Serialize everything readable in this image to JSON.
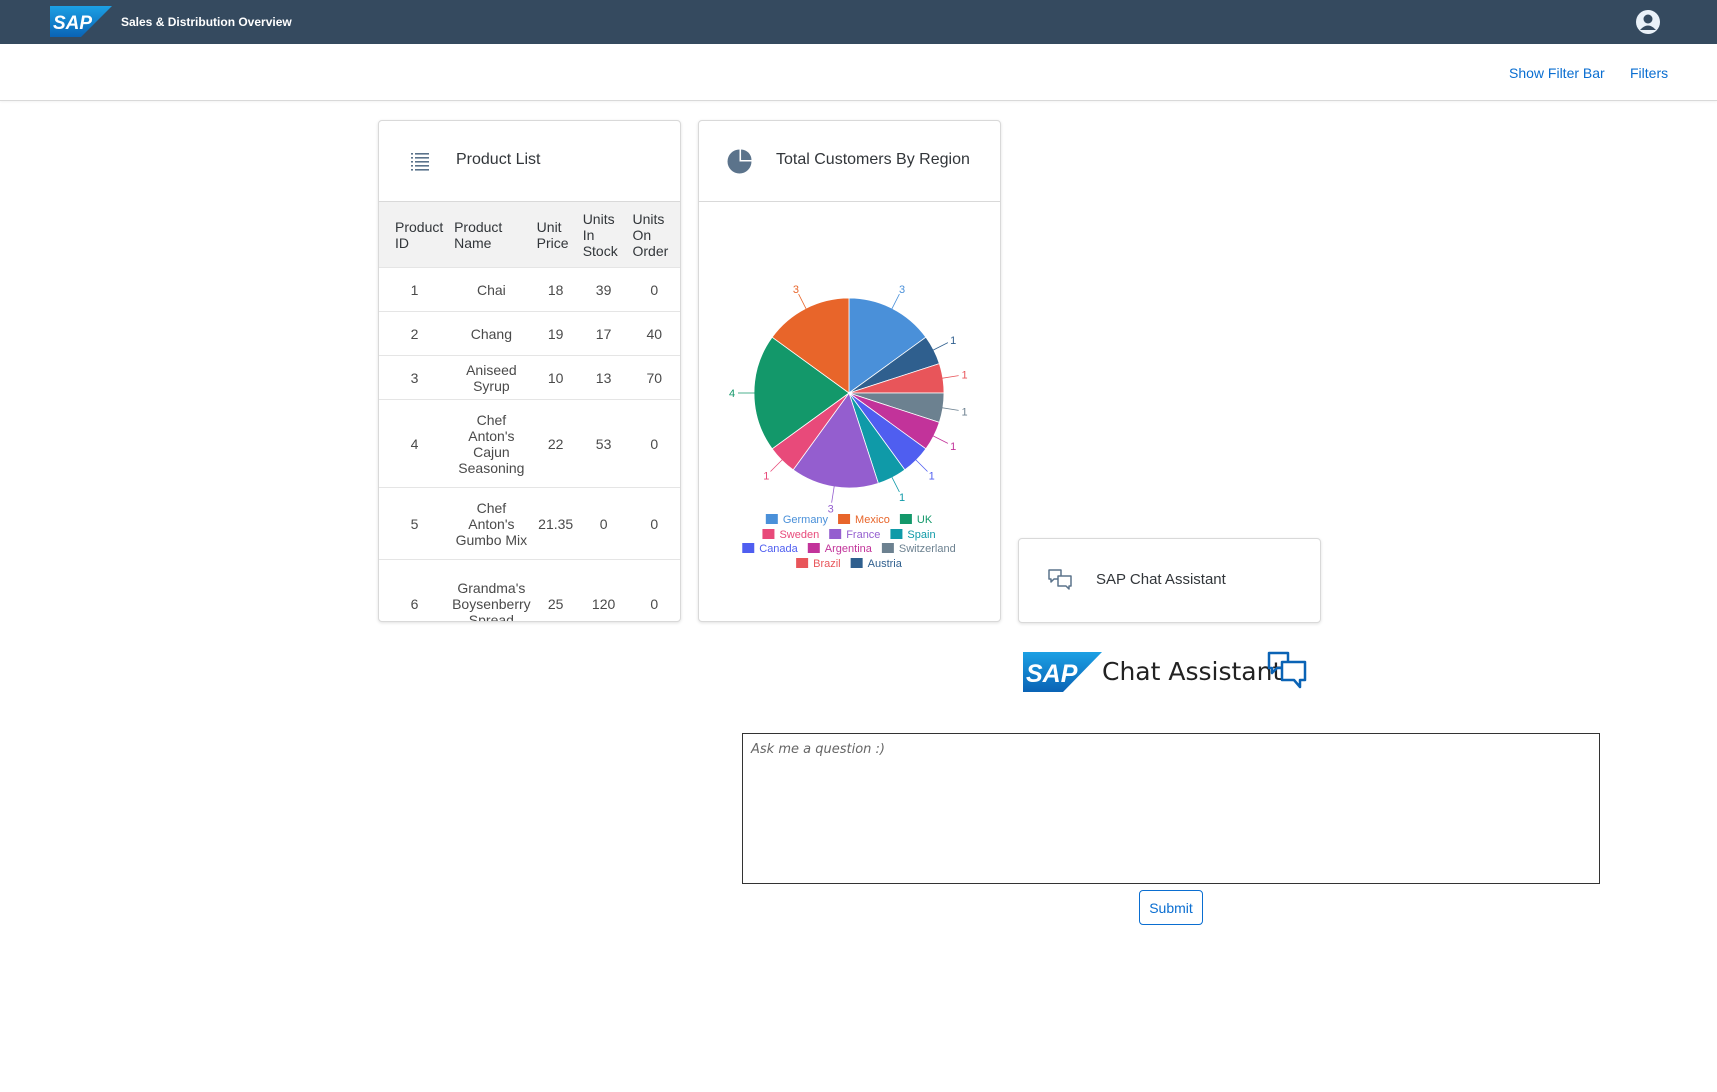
{
  "shell": {
    "app_title": "Sales & Distribution Overview",
    "logo_text": "SAP",
    "avatar_icon": "user-avatar-icon",
    "brand_bg": "#354a5f"
  },
  "toolbar": {
    "show_filter_bar": "Show Filter Bar",
    "filters": "Filters"
  },
  "product_card": {
    "title": "Product List",
    "icon": "list-icon",
    "columns": [
      "Product ID",
      "Product Name",
      "Unit Price",
      "Units In Stock",
      "Units On Order"
    ],
    "rows": [
      [
        "1",
        "Chai",
        "18",
        "39",
        "0"
      ],
      [
        "2",
        "Chang",
        "19",
        "17",
        "40"
      ],
      [
        "3",
        "Aniseed Syrup",
        "10",
        "13",
        "70"
      ],
      [
        "4",
        "Chef Anton's Cajun Seasoning",
        "22",
        "53",
        "0"
      ],
      [
        "5",
        "Chef Anton's Gumbo Mix",
        "21.35",
        "0",
        "0"
      ],
      [
        "6",
        "Grandma's Boysenberry Spread",
        "25",
        "120",
        "0"
      ]
    ]
  },
  "customers_card": {
    "title": "Total Customers By Region",
    "icon": "pie-chart-icon"
  },
  "chart_data": {
    "type": "pie",
    "title": "",
    "legend_position": "bottom",
    "slices": [
      {
        "label": "Germany",
        "value": 3,
        "color": "#4a90d9"
      },
      {
        "label": "Austria",
        "value": 1,
        "color": "#2f5f8e"
      },
      {
        "label": "Brazil",
        "value": 1,
        "color": "#e8555a"
      },
      {
        "label": "Switzerland",
        "value": 1,
        "color": "#6c8190"
      },
      {
        "label": "Argentina",
        "value": 1,
        "color": "#c2339a"
      },
      {
        "label": "Canada",
        "value": 1,
        "color": "#4f5ef0"
      },
      {
        "label": "Spain",
        "value": 1,
        "color": "#0f9aa8"
      },
      {
        "label": "France",
        "value": 3,
        "color": "#945ecf"
      },
      {
        "label": "Sweden",
        "value": 1,
        "color": "#e84a7a"
      },
      {
        "label": "UK",
        "value": 4,
        "color": "#13986a"
      },
      {
        "label": "Mexico",
        "value": 3,
        "color": "#e8652a"
      }
    ],
    "legend_order": [
      [
        "Germany",
        "Mexico",
        "UK"
      ],
      [
        "Sweden",
        "France",
        "Spain"
      ],
      [
        "Canada",
        "Argentina",
        "Switzerland"
      ],
      [
        "Brazil",
        "Austria"
      ]
    ]
  },
  "chat_card": {
    "title": "SAP Chat Assistant",
    "icon": "chat-bubbles-icon"
  },
  "chat_panel": {
    "logo_text": "SAP",
    "heading": "Chat Assistant",
    "heading_icon": "chat-bubbles-icon",
    "placeholder": "Ask me a question :)",
    "submit_label": "Submit"
  }
}
